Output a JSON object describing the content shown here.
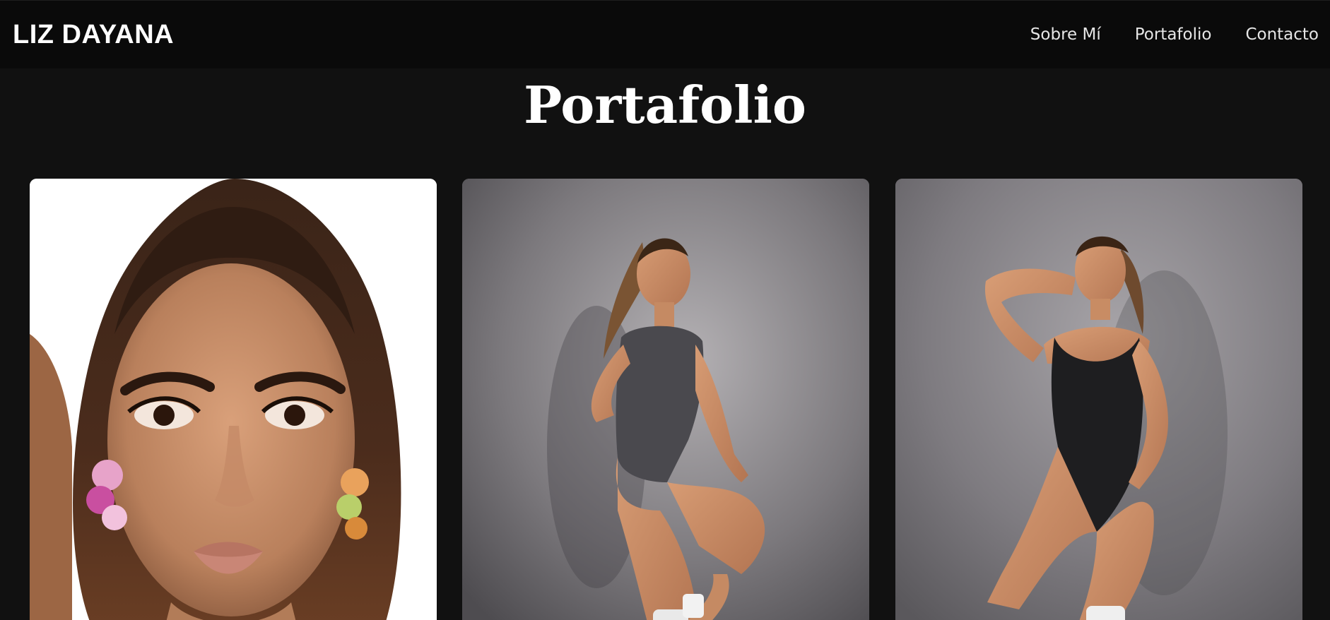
{
  "header": {
    "brand": "LIZ DAYANA",
    "nav": [
      {
        "label": "Sobre Mí"
      },
      {
        "label": "Portafolio"
      },
      {
        "label": "Contacto"
      }
    ]
  },
  "portfolio": {
    "title": "Portafolio"
  },
  "colors": {
    "page_background": "#111111",
    "navbar_background": "#0a0a0a",
    "text": "#ffffff"
  }
}
